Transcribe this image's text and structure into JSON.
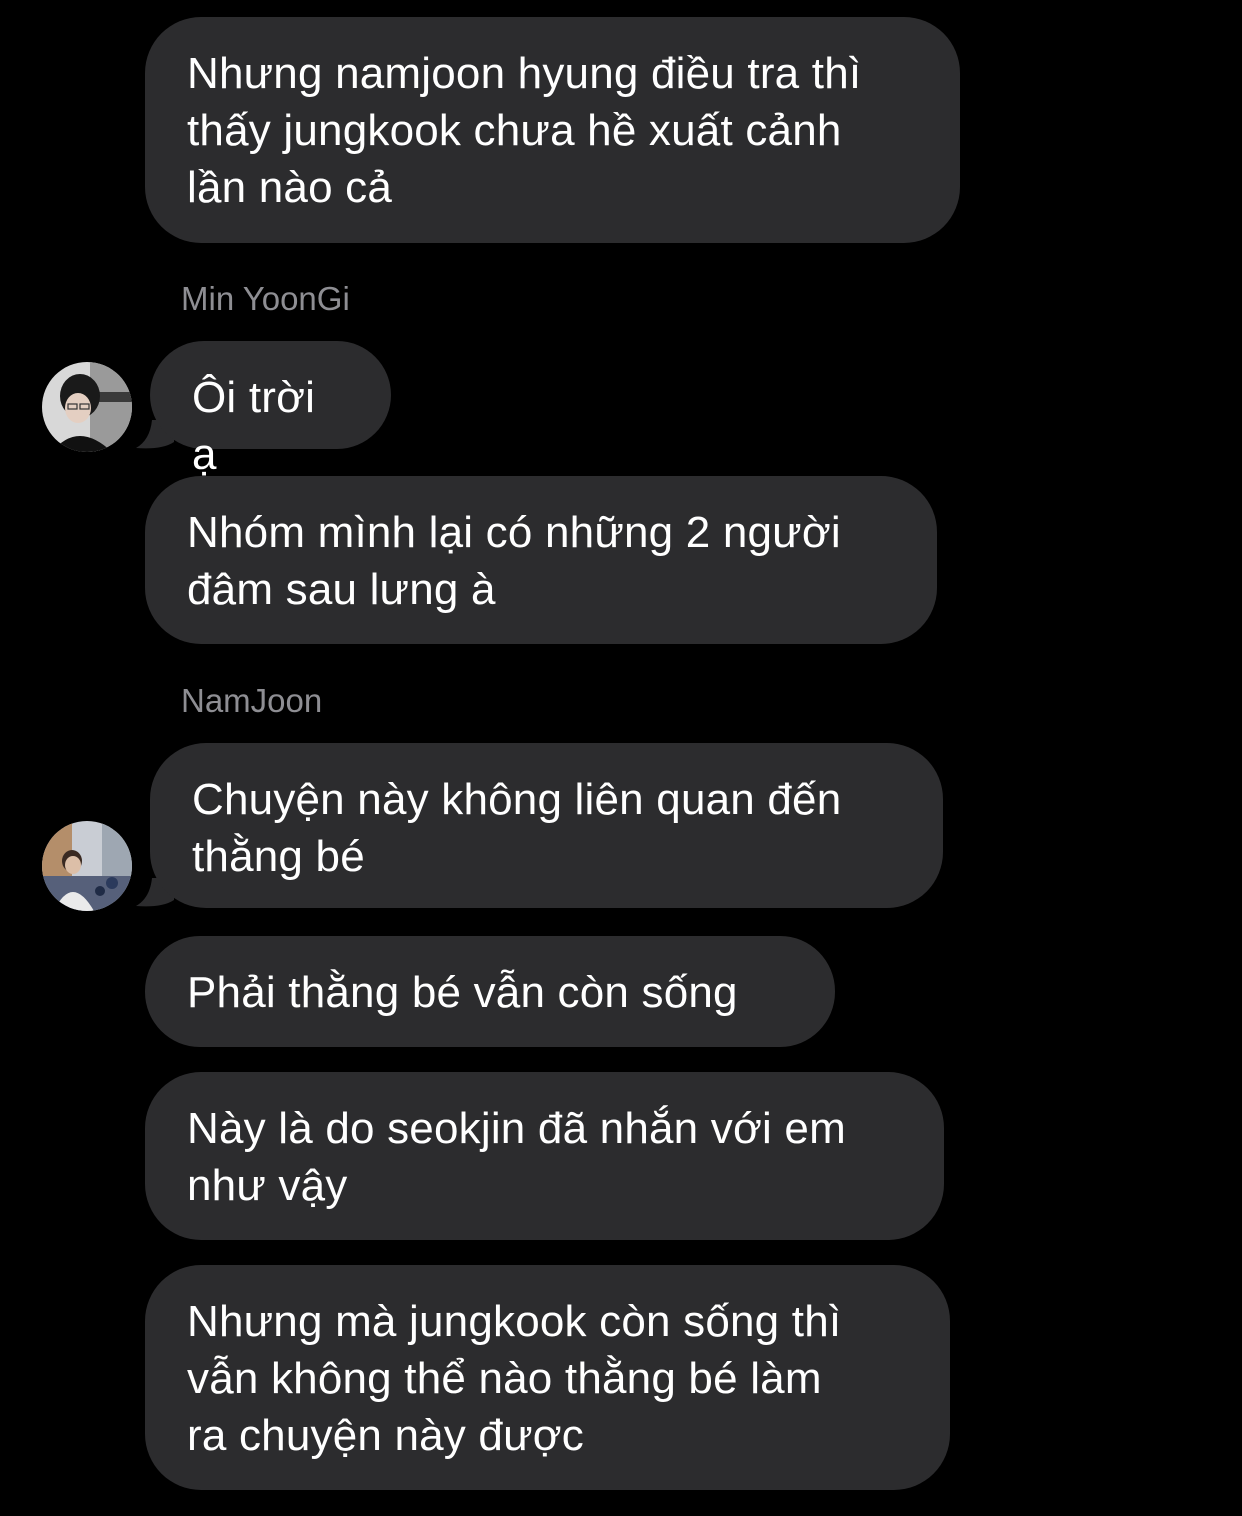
{
  "conversation": {
    "messages": [
      {
        "text": "Nhưng namjoon hyung điều tra thì\nthấy jungkook chưa hề xuất cảnh\nlần nào cả"
      },
      {
        "sender": "Min YoonGi",
        "text": "Ôi trời ạ",
        "avatar": "yoongi-avatar"
      },
      {
        "text": "Nhóm mình lại có những 2 người\nđâm sau lưng à"
      },
      {
        "sender": "NamJoon",
        "text": "Chuyện này không liên quan đến\nthằng bé",
        "avatar": "namjoon-avatar"
      },
      {
        "text": "Phải thằng bé vẫn còn sống"
      },
      {
        "text": "Này là do seokjin đã nhắn với em\nnhư vậy"
      },
      {
        "text": "Nhưng mà jungkook còn sống thì\nvẫn không thể nào thằng bé làm\nra chuyện này được"
      }
    ]
  },
  "colors": {
    "background": "#000000",
    "bubble": "#2c2c2e",
    "text": "#ffffff",
    "sender": "#8e8e93"
  }
}
